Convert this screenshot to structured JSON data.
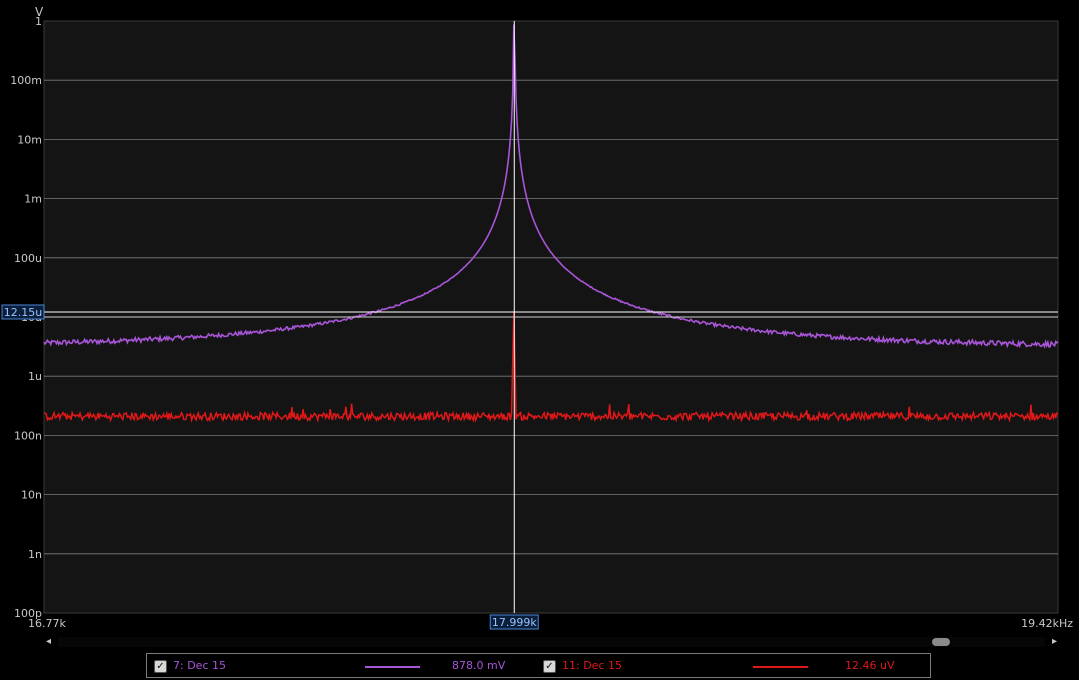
{
  "chart_data": {
    "type": "line",
    "title": "",
    "ylabel": "V",
    "xlabel": "",
    "x_range_khz": [
      16.77,
      19.42
    ],
    "y_scale": "log",
    "y_range": [
      1e-10,
      1
    ],
    "y_tick_labels": [
      "1",
      "100m",
      "10m",
      "1m",
      "100u",
      "10u",
      "1u",
      "100n",
      "10n",
      "1n",
      "100p"
    ],
    "x_tick_labels": {
      "start": "16.77k",
      "end": "19.42kHz"
    },
    "grid": true,
    "cursor": {
      "x_label": "17.999k",
      "x_khz": 17.999,
      "y_label": "12.15u",
      "y_value": 1.215e-05
    },
    "series": [
      {
        "name": "7: Dec 15",
        "color": "#a855d8",
        "peak_value_label": "878.0 mV",
        "peak_x_khz": 17.999,
        "peak_value": 0.878,
        "baseline_value": 2.9e-06
      },
      {
        "name": "11: Dec 15",
        "color": "#e01818",
        "peak_value_label": "12.46 uV",
        "peak_x_khz": 17.999,
        "peak_value": 1.246e-05,
        "baseline_value": 2.1e-07
      }
    ]
  },
  "legend": {
    "items": [
      {
        "checked": true,
        "label": "7: Dec 15",
        "value": "878.0 mV",
        "color": "#a855d8"
      },
      {
        "checked": true,
        "label": "11: Dec 15",
        "value": "12.46 uV",
        "color": "#e01818"
      }
    ]
  },
  "scrollbar": {
    "left_arrow": "◂",
    "right_arrow": "▸"
  }
}
